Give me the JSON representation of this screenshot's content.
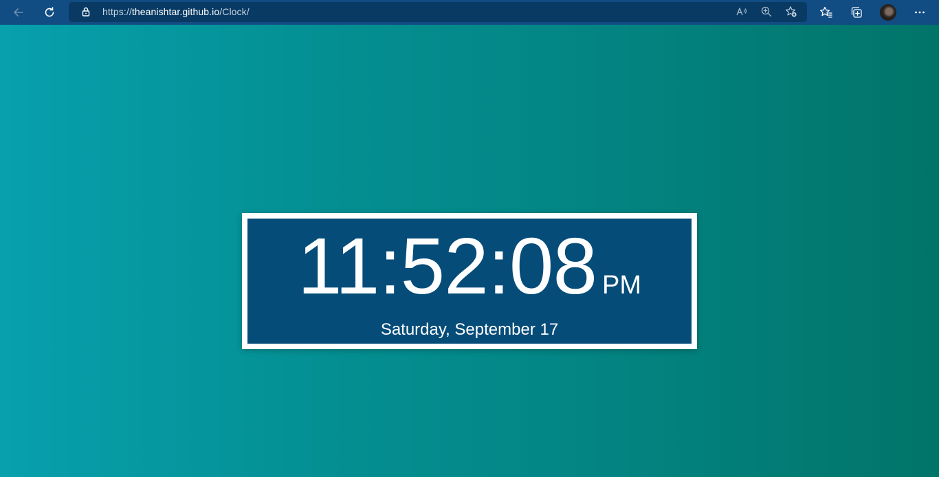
{
  "browser": {
    "url_scheme": "https://",
    "url_host": "theanishtar.github.io",
    "url_path": "/Clock/",
    "icons": {
      "back": "back-arrow-icon",
      "refresh": "refresh-icon",
      "lock": "lock-icon",
      "read_aloud": "read-aloud-icon",
      "zoom": "zoom-icon",
      "add_favorite": "add-favorite-icon",
      "favorites": "favorites-icon",
      "collections": "collections-icon",
      "profile": "avatar",
      "more": "more-icon"
    },
    "colors": {
      "toolbar": "#114c83",
      "addressbar": "#083a64"
    }
  },
  "clock": {
    "time": "11:52:08",
    "period": "PM",
    "date": "Saturday, September 17"
  },
  "colors": {
    "background_left": "#07a0ad",
    "background_right": "#017468",
    "clock_frame": "#ffffff",
    "clock_panel": "#054c79",
    "text": "#ffffff"
  }
}
